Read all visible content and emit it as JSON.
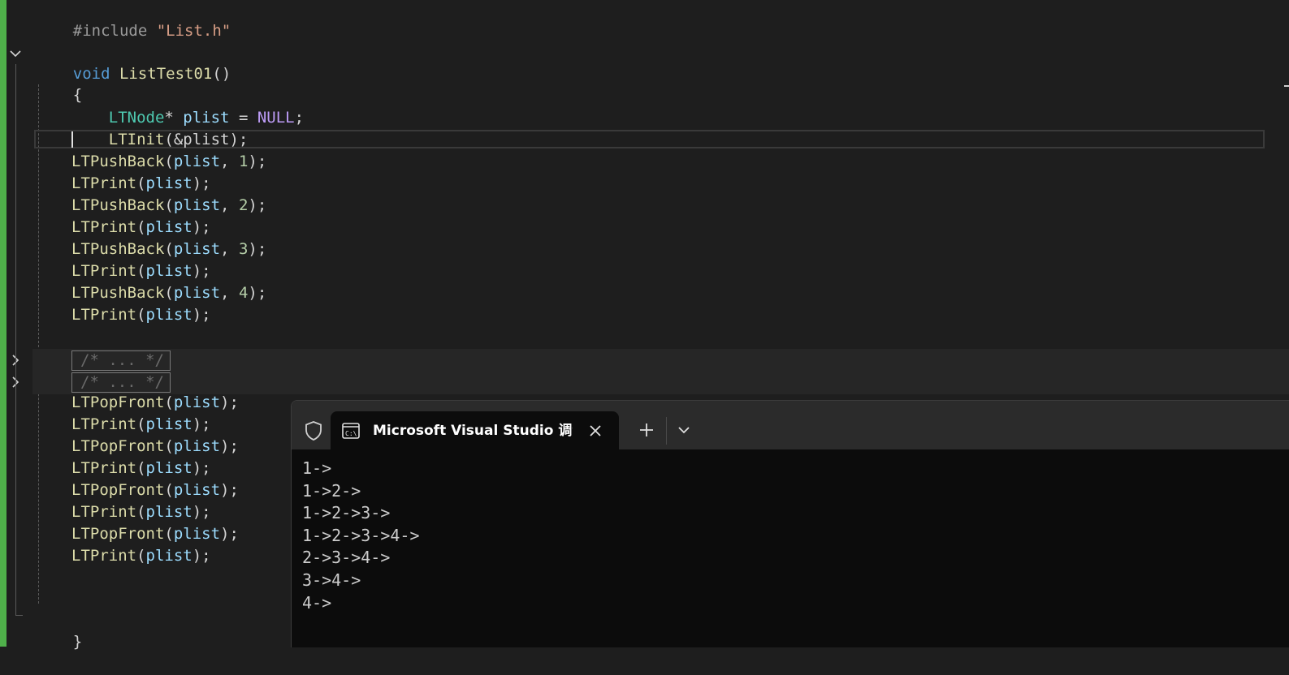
{
  "editor": {
    "include_directive": "#include",
    "include_file": "\"List.h\"",
    "func_keyword": "void",
    "func_name": "ListTest01",
    "func_parens": "()",
    "open_brace": "{",
    "close_brace": "}",
    "decl": {
      "type": "LTNode",
      "star": "* ",
      "var": "plist",
      "eq": " = ",
      "value": "NULL",
      "semi": ";"
    },
    "init_call": {
      "fn": "LTInit",
      "args": "(&plist);"
    },
    "push_back_lines": [
      {
        "fn": "LTPushBack",
        "open": "(",
        "arg": "plist",
        "comma": ", ",
        "num": "1",
        "close": ");"
      },
      {
        "fn": "LTPushBack",
        "open": "(",
        "arg": "plist",
        "comma": ", ",
        "num": "2",
        "close": ");"
      },
      {
        "fn": "LTPushBack",
        "open": "(",
        "arg": "plist",
        "comma": ", ",
        "num": "3",
        "close": ");"
      },
      {
        "fn": "LTPushBack",
        "open": "(",
        "arg": "plist",
        "comma": ", ",
        "num": "4",
        "close": ");"
      }
    ],
    "print_fn": "LTPrint",
    "pop_front_fn": "LTPopFront",
    "arg_var": "plist",
    "collapsed_blocks": [
      "/* ... */",
      "/* ... */"
    ]
  },
  "terminal": {
    "tab_title": "Microsoft Visual Studio 调试控制台",
    "icons": [
      "shield-icon",
      "console-icon",
      "close-icon",
      "plus-icon",
      "chevron-down-icon"
    ],
    "output_lines": [
      "1->",
      "1->2->",
      "1->2->3->",
      "1->2->3->4->",
      "2->3->4->",
      "3->4->",
      "4->"
    ]
  }
}
